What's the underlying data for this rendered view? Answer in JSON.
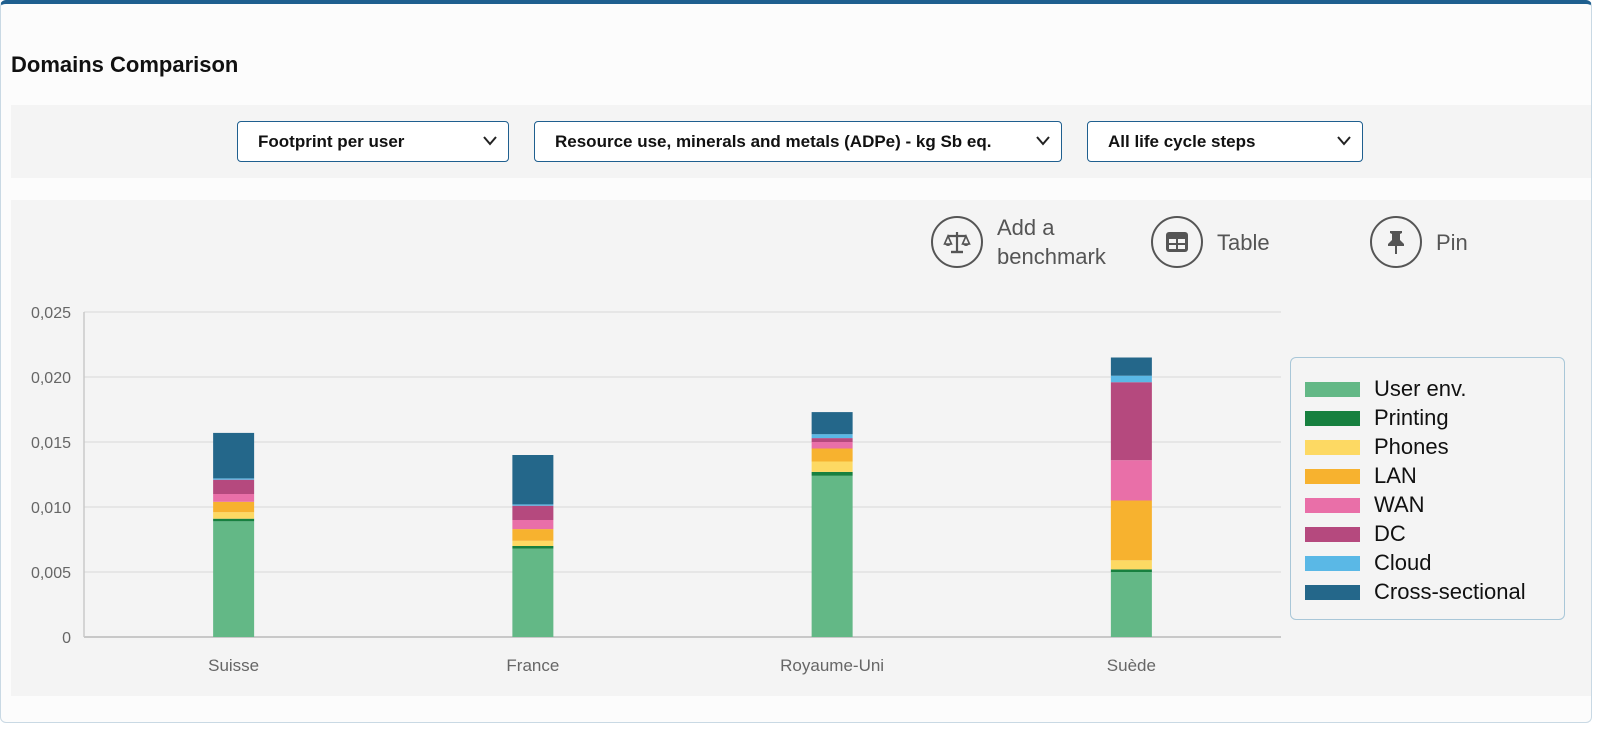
{
  "header": {
    "title": "Domains Comparison"
  },
  "filters": {
    "metric": "Footprint per user",
    "indicator": "Resource use, minerals and metals (ADPe) - kg Sb eq.",
    "lifecycle": "All life cycle steps"
  },
  "toolbar": {
    "benchmark_label_line1": "Add a",
    "benchmark_label_line2": "benchmark",
    "table_label": "Table",
    "pin_label": "Pin"
  },
  "chart_data": {
    "type": "bar",
    "stacked": true,
    "categories": [
      "Suisse",
      "France",
      "Royaume-Uni",
      "Suède"
    ],
    "ylim": [
      0,
      0.025
    ],
    "yticks": [
      "0",
      "0,005",
      "0,010",
      "0,015",
      "0,020",
      "0,025"
    ],
    "grid": true,
    "legend_position": "right",
    "series": [
      {
        "name": "User env.",
        "color": "#63b886",
        "values": [
          0.0089,
          0.0068,
          0.0124,
          0.005
        ]
      },
      {
        "name": "Printing",
        "color": "#17803f",
        "values": [
          0.0002,
          0.0002,
          0.0003,
          0.0002
        ]
      },
      {
        "name": "Phones",
        "color": "#fdd963",
        "values": [
          0.0005,
          0.0004,
          0.0008,
          0.0007
        ]
      },
      {
        "name": "LAN",
        "color": "#f7b22f",
        "values": [
          0.0008,
          0.0009,
          0.001,
          0.0046
        ]
      },
      {
        "name": "WAN",
        "color": "#e96fa8",
        "values": [
          0.0006,
          0.0007,
          0.0005,
          0.0031
        ]
      },
      {
        "name": "DC",
        "color": "#b5497e",
        "values": [
          0.0011,
          0.0011,
          0.0003,
          0.006
        ]
      },
      {
        "name": "Cloud",
        "color": "#5ab8e6",
        "values": [
          0.0001,
          0.0001,
          0.0003,
          0.0005
        ]
      },
      {
        "name": "Cross-sectional",
        "color": "#24678a",
        "values": [
          0.0035,
          0.0038,
          0.0017,
          0.0014
        ]
      }
    ]
  }
}
